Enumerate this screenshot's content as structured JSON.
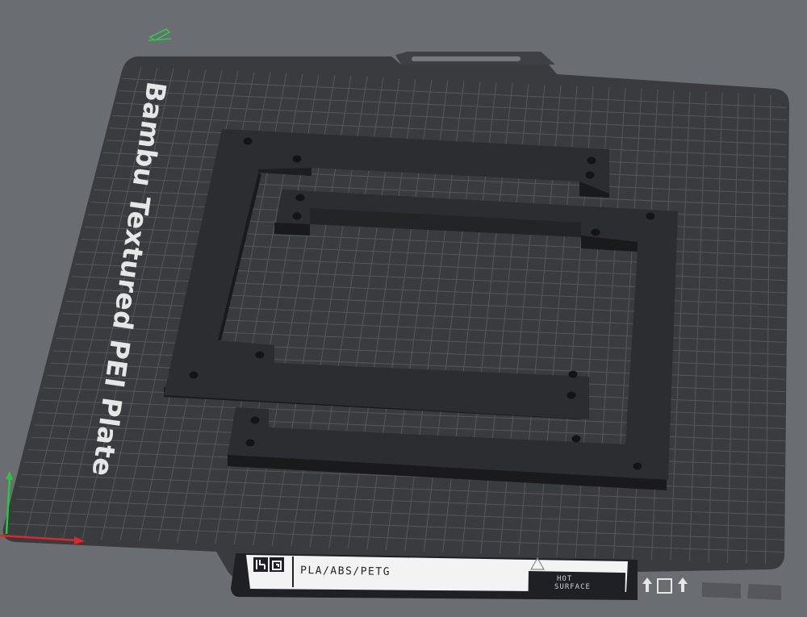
{
  "plate": {
    "brand_label": "Bambu Textured PEI Plate",
    "material_label": "PLA/ABS/PETG",
    "warning_line1": "HOT",
    "warning_line2": "SURFACE"
  },
  "icons": {
    "object_marker": "pencil-icon",
    "axes": "xyz-axis-icon",
    "warning": "warning-triangle-icon",
    "bottom_icons": [
      "arrow-up-icon",
      "square-icon",
      "arrow-up-icon"
    ]
  },
  "colors": {
    "background": "#6a6d72",
    "plate": "#3a3b3f",
    "grid": "#5a5c61",
    "part_top": "#2c2d30",
    "part_side": "#1a1a1c",
    "x_axis": "#e0262a",
    "y_axis": "#28c83c",
    "marker": "#32c850"
  }
}
